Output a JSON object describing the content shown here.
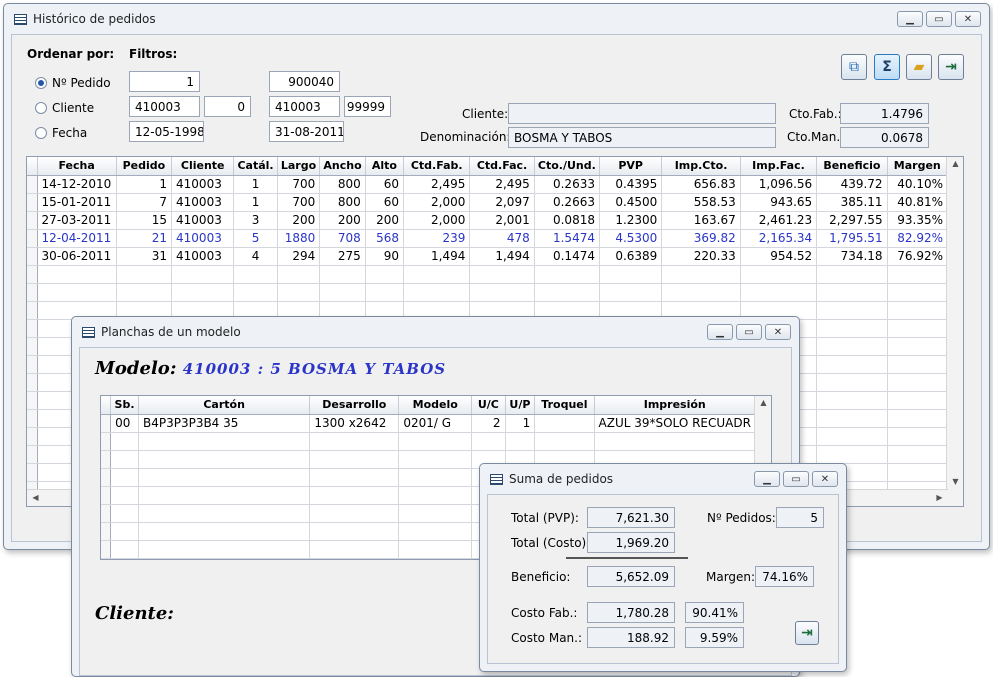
{
  "main_window": {
    "title": "Histórico de pedidos",
    "order_label": "Ordenar por:",
    "filters_label": "Filtros:",
    "radios": [
      {
        "label": "Nº Pedido",
        "checked": true
      },
      {
        "label": "Cliente",
        "checked": false
      },
      {
        "label": "Fecha",
        "checked": false
      }
    ],
    "filters": {
      "pedido_from": "1",
      "pedido_to": "900040",
      "cliente_from": "410003",
      "cliente_sub": "0",
      "cliente_to": "410003",
      "cliente_sub_to": "99999",
      "fecha_from": "12-05-1998",
      "fecha_to": "31-08-2011"
    },
    "cliente_label": "Cliente:",
    "cliente_value": "",
    "denominacion_label": "Denominación:",
    "denominacion_value": "BOSMA Y TABOS",
    "cto_fab_label": "Cto.Fab.:",
    "cto_fab_value": "1.4796",
    "cto_man_label": "Cto.Man.:",
    "cto_man_value": "0.0678",
    "columns": [
      "Fecha",
      "Pedido",
      "Cliente",
      "Catál.",
      "Largo",
      "Ancho",
      "Alto",
      "Ctd.Fab.",
      "Ctd.Fac.",
      "Cto./Und.",
      "PVP",
      "Imp.Cto.",
      "Imp.Fac.",
      "Beneficio",
      "Margen"
    ],
    "rows": [
      [
        "14-12-2010",
        "1",
        "410003",
        "1",
        "700",
        "800",
        "60",
        "2,495",
        "2,495",
        "0.2633",
        "0.4395",
        "656.83",
        "1,096.56",
        "439.72",
        "40.10%"
      ],
      [
        "15-01-2011",
        "7",
        "410003",
        "1",
        "700",
        "800",
        "60",
        "2,000",
        "2,097",
        "0.2663",
        "0.4500",
        "558.53",
        "943.65",
        "385.11",
        "40.81%"
      ],
      [
        "27-03-2011",
        "15",
        "410003",
        "3",
        "200",
        "200",
        "200",
        "2,000",
        "2,001",
        "0.0818",
        "1.2300",
        "163.67",
        "2,461.23",
        "2,297.55",
        "93.35%"
      ],
      [
        "12-04-2011",
        "21",
        "410003",
        "5",
        "1880",
        "708",
        "568",
        "239",
        "478",
        "1.5474",
        "4.5300",
        "369.82",
        "2,165.34",
        "1,795.51",
        "82.92%"
      ],
      [
        "30-06-2011",
        "31",
        "410003",
        "4",
        "294",
        "275",
        "90",
        "1,494",
        "1,494",
        "0.1474",
        "0.6389",
        "220.33",
        "954.52",
        "734.18",
        "76.92%"
      ]
    ],
    "highlight_row": 3
  },
  "planchas_window": {
    "title": "Planchas de un modelo",
    "modelo_label": "Modelo:",
    "modelo_value": "410003 : 5  BOSMA Y TABOS",
    "cliente_label": "Cliente:",
    "columns": [
      "Sb.",
      "Cartón",
      "Desarrollo",
      "Modelo",
      "U/C",
      "U/P",
      "Troquel",
      "Impresión"
    ],
    "rows": [
      [
        "00",
        "B4P3P3P3B4 35",
        "1300 x2642",
        "0201/   G",
        "2",
        "1",
        "",
        "AZUL 39*SOLO RECUADR"
      ]
    ]
  },
  "suma_window": {
    "title": "Suma de pedidos",
    "total_pvp_label": "Total (PVP):",
    "total_pvp": "7,621.30",
    "n_pedidos_label": "Nº Pedidos:",
    "n_pedidos": "5",
    "total_costo_label": "Total (Costo):",
    "total_costo": "1,969.20",
    "beneficio_label": "Beneficio:",
    "beneficio": "5,652.09",
    "margen_label": "Margen:",
    "margen": "74.16%",
    "costo_fab_label": "Costo Fab.:",
    "costo_fab": "1,780.28",
    "costo_fab_pct": "90.41%",
    "costo_man_label": "Costo Man.:",
    "costo_man": "188.92",
    "costo_man_pct": "9.59%"
  }
}
